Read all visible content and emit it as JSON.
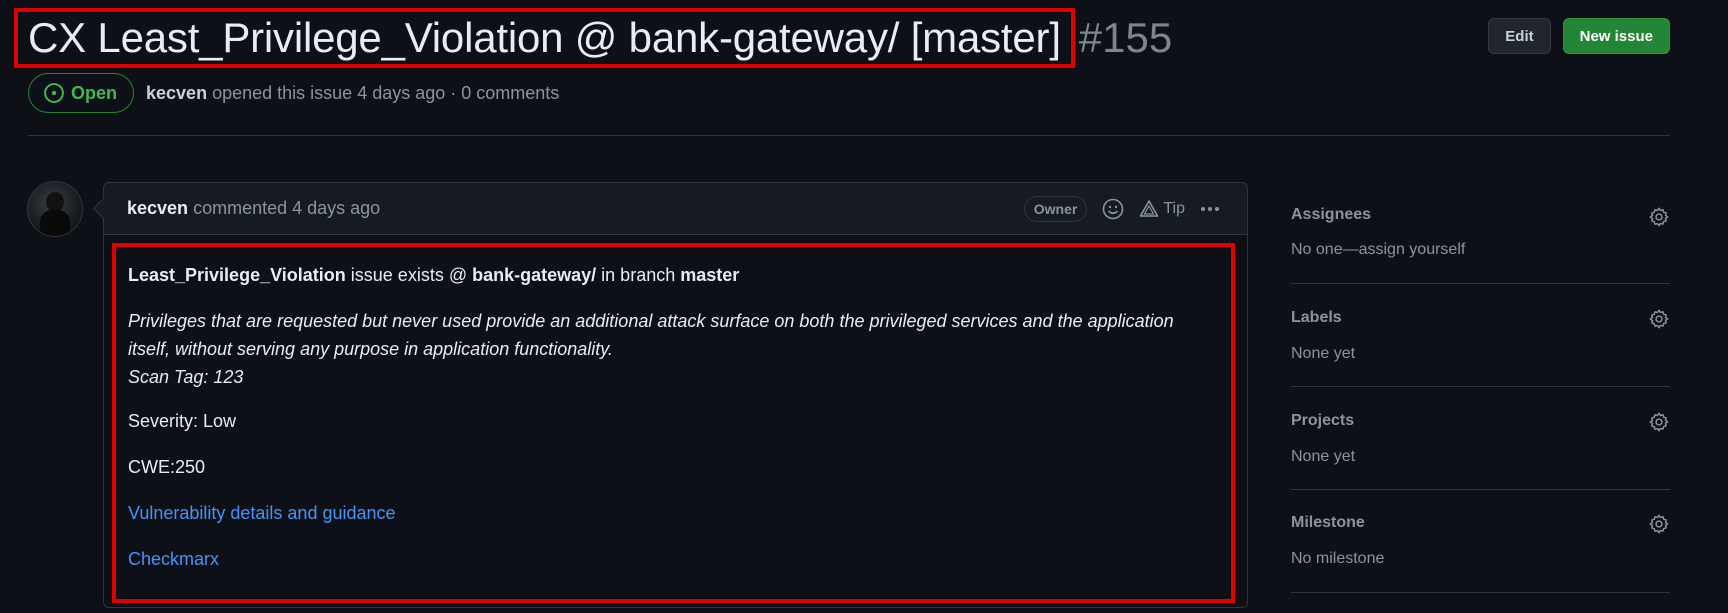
{
  "issue": {
    "title": "CX Least_Privilege_Violation @ bank-gateway/ [master]",
    "number": "#155",
    "state": "Open",
    "author": "kecven",
    "opened_text": "opened this issue 4 days ago · 0 comments"
  },
  "header_actions": {
    "edit_label": "Edit",
    "new_issue_label": "New issue"
  },
  "comment": {
    "author": "kecven",
    "commented_text": "commented 4 days ago",
    "owner_badge": "Owner",
    "tip_label": "Tip",
    "body": {
      "query_name": "Least_Privilege_Violation",
      "exists_text": "issue exists @",
      "project": "bank-gateway/",
      "in_branch_text": "in branch",
      "branch": "master",
      "description_line1": "Privileges that are requested but never used provide an additional attack surface on both the privileged services and the application",
      "description_line2": "itself, without serving any purpose in application functionality.",
      "scan_tag": "Scan Tag: 123",
      "severity": "Severity: Low",
      "cwe": "CWE:250",
      "details_link": "Vulnerability details and guidance",
      "checkmarx_link": "Checkmarx"
    }
  },
  "sidebar": {
    "assignees": {
      "title": "Assignees",
      "value": "No one—assign yourself"
    },
    "labels": {
      "title": "Labels",
      "value": "None yet"
    },
    "projects": {
      "title": "Projects",
      "value": "None yet"
    },
    "milestone": {
      "title": "Milestone",
      "value": "No milestone"
    }
  },
  "colors": {
    "background": "#0d1117",
    "open_green": "#3fb950",
    "button_green": "#238636",
    "link_blue": "#4493f8",
    "highlight_red": "#e00000"
  }
}
